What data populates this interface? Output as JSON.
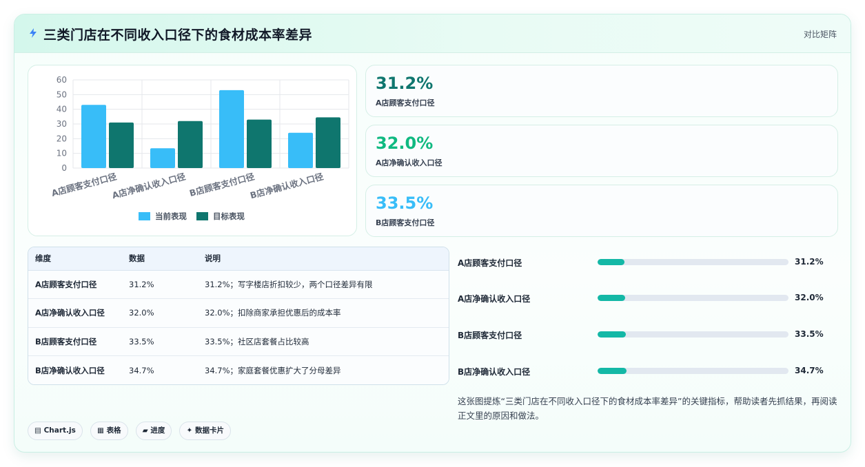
{
  "header": {
    "title": "三类门店在不同收入口径下的食材成本率差异",
    "tag": "对比矩阵",
    "icon": "lightning-icon"
  },
  "chart_data": {
    "type": "bar",
    "categories": [
      "A店顾客支付口径",
      "A店净确认收入口径",
      "B店顾客支付口径",
      "B店净确认收入口径"
    ],
    "series": [
      {
        "name": "当前表现",
        "values": [
          43,
          13.5,
          53,
          24
        ],
        "color": "#38bdf8"
      },
      {
        "name": "目标表现",
        "values": [
          31,
          32,
          33,
          34.5
        ],
        "color": "#0f766e"
      }
    ],
    "ylim": [
      0,
      60
    ],
    "yticks": [
      "0",
      "10",
      "20",
      "30",
      "40",
      "50",
      "60"
    ],
    "grid": true,
    "legend": "bottom"
  },
  "stats": [
    {
      "value": "31.2%",
      "label": "A店顾客支付口径",
      "color": "#0f766e"
    },
    {
      "value": "32.0%",
      "label": "A店净确认收入口径",
      "color": "#10b981"
    },
    {
      "value": "33.5%",
      "label": "B店顾客支付口径",
      "color": "#38bdf8"
    }
  ],
  "table": {
    "headers": [
      "维度",
      "数据",
      "说明"
    ],
    "rows": [
      [
        "A店顾客支付口径",
        "31.2%",
        "31.2%；写字楼店折扣较少，两个口径差异有限"
      ],
      [
        "A店净确认收入口径",
        "32.0%",
        "32.0%；扣除商家承担优惠后的成本率"
      ],
      [
        "B店顾客支付口径",
        "33.5%",
        "33.5%；社区店套餐占比较高"
      ],
      [
        "B店净确认收入口径",
        "34.7%",
        "34.7%；家庭套餐优惠扩大了分母差异"
      ]
    ]
  },
  "progress": [
    {
      "label": "A店顾客支付口径",
      "value": "31.2%",
      "fraction": 0.141
    },
    {
      "label": "A店净确认收入口径",
      "value": "32.0%",
      "fraction": 0.144
    },
    {
      "label": "B店顾客支付口径",
      "value": "33.5%",
      "fraction": 0.148
    },
    {
      "label": "B店净确认收入口径",
      "value": "34.7%",
      "fraction": 0.152
    }
  ],
  "note": "这张图提炼“三类门店在不同收入口径下的食材成本率差异”的关键指标，帮助读者先抓结果，再阅读正文里的原因和做法。",
  "chips": [
    {
      "icon": "▤",
      "label": "Chart.js"
    },
    {
      "icon": "▦",
      "label": "表格"
    },
    {
      "icon": "▰",
      "label": "进度"
    },
    {
      "icon": "✦",
      "label": "数据卡片"
    }
  ]
}
